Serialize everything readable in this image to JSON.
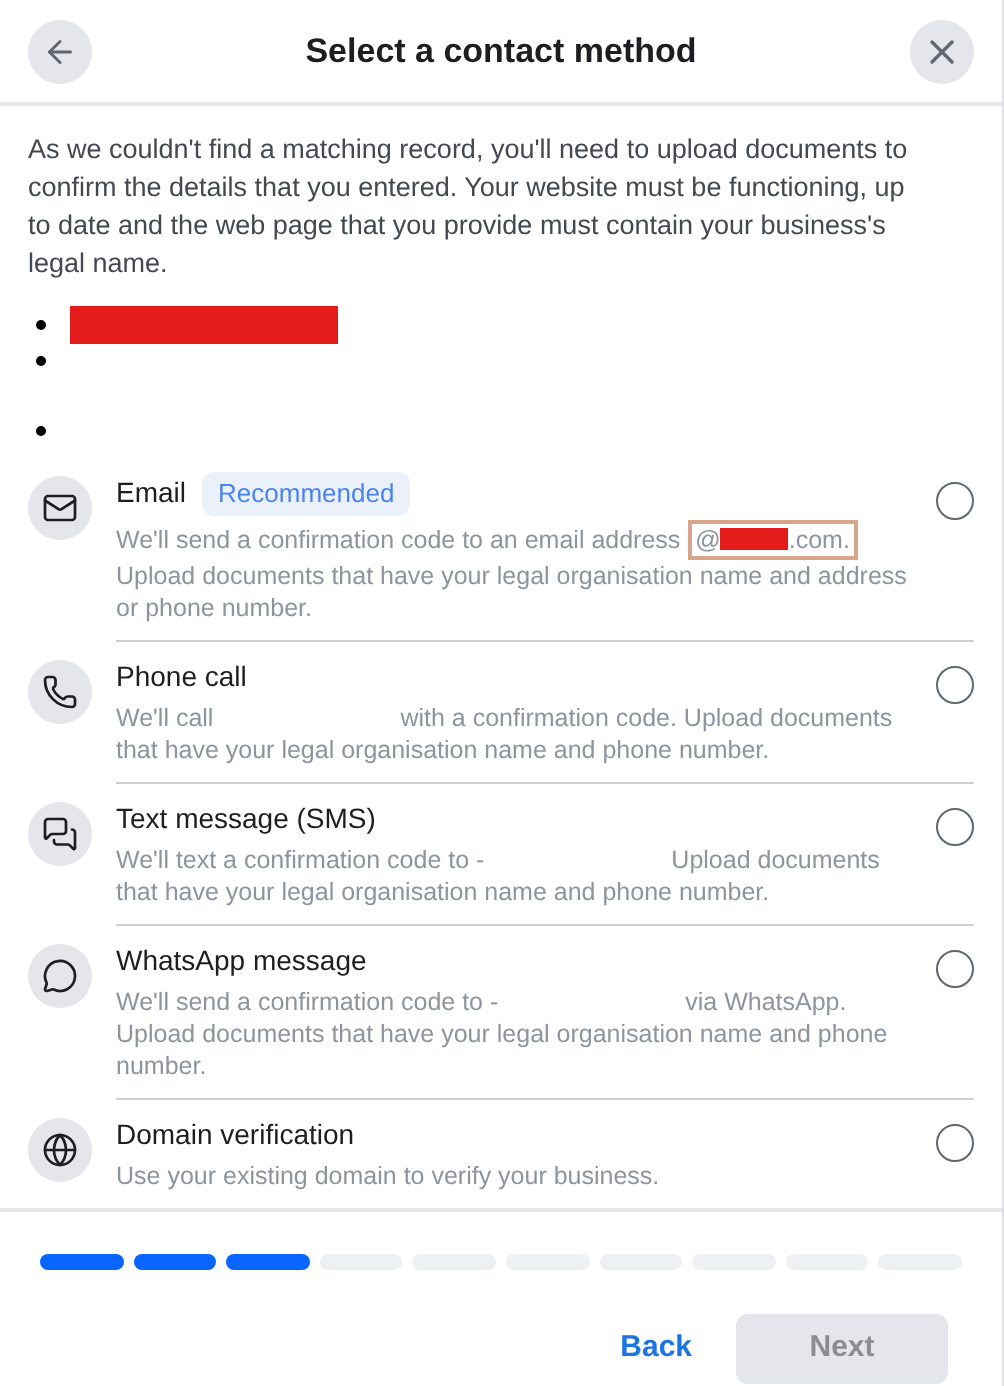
{
  "header": {
    "title": "Select a contact method"
  },
  "intro": "As we couldn't find a matching record, you'll need to upload documents to confirm the details that you entered. Your website must be functioning, up to date and the web page that you provide must contain your business's legal name.",
  "bullets": [
    {
      "redacted": true
    },
    {
      "redacted": false
    },
    {
      "redacted": false
    }
  ],
  "options": [
    {
      "kind": "email",
      "title": "Email",
      "badge": "Recommended",
      "selected": false,
      "description": [
        {
          "kind": "text",
          "text": "We'll send a confirmation code to an email address"
        },
        {
          "kind": "highlight",
          "before": "@",
          "after": ".com."
        },
        {
          "kind": "text",
          "text": "Upload documents that have your legal organisation name and address or phone number."
        }
      ]
    },
    {
      "kind": "phone",
      "title": "Phone call",
      "selected": false,
      "description": [
        {
          "kind": "text",
          "text": "We'll call"
        },
        {
          "kind": "gap"
        },
        {
          "kind": "text",
          "text": "with a confirmation code. Upload documents that have your legal organisation name and phone number."
        }
      ]
    },
    {
      "kind": "sms",
      "title": "Text message (SMS)",
      "selected": false,
      "description": [
        {
          "kind": "text",
          "text": "We'll text a confirmation code to -"
        },
        {
          "kind": "gap"
        },
        {
          "kind": "text",
          "text": "Upload documents that have your legal organisation name and phone number."
        }
      ]
    },
    {
      "kind": "whatsapp",
      "title": "WhatsApp message",
      "selected": false,
      "description": [
        {
          "kind": "text",
          "text": "We'll send a confirmation code to -"
        },
        {
          "kind": "gap"
        },
        {
          "kind": "text",
          "text": "via WhatsApp. Upload documents that have your legal organisation name and phone number."
        }
      ]
    },
    {
      "kind": "domain",
      "title": "Domain verification",
      "selected": false,
      "description": [
        {
          "kind": "text",
          "text": "Use your existing domain to verify your business."
        }
      ]
    }
  ],
  "steps": [
    {
      "done": true
    },
    {
      "done": true
    },
    {
      "done": true
    },
    {
      "done": false
    },
    {
      "done": false
    },
    {
      "done": false
    },
    {
      "done": false
    },
    {
      "done": false
    },
    {
      "done": false
    },
    {
      "done": false
    }
  ],
  "footer": {
    "back": "Back",
    "next": {
      "label": "Next",
      "disabled": true
    }
  }
}
